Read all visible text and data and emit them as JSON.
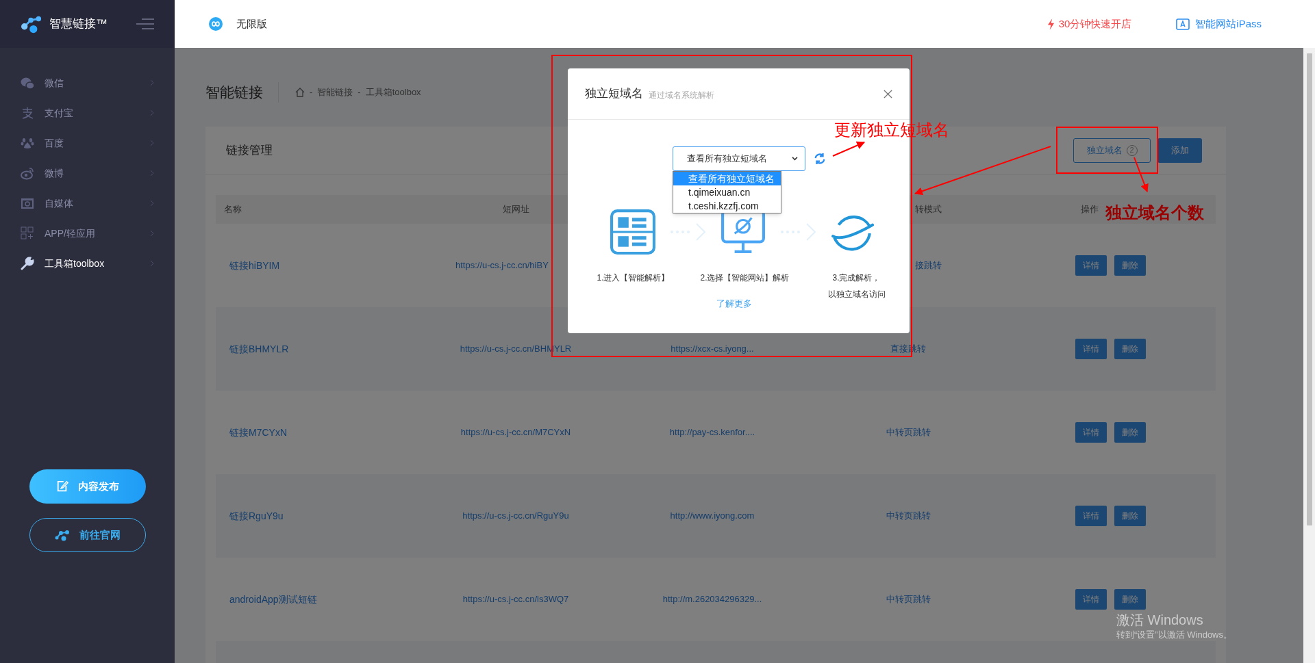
{
  "sidebar": {
    "logo_text": "智慧链接™",
    "items": [
      {
        "label": "微信",
        "kind": "wechat",
        "selected": false
      },
      {
        "label": "支付宝",
        "kind": "alipay",
        "selected": false
      },
      {
        "label": "百度",
        "kind": "baidu",
        "selected": false
      },
      {
        "label": "微博",
        "kind": "weibo",
        "selected": false
      },
      {
        "label": "自媒体",
        "kind": "media",
        "selected": false
      },
      {
        "label": "APP/轻应用",
        "kind": "app",
        "selected": false
      },
      {
        "label": "工具箱toolbox",
        "kind": "toolbox",
        "selected": true
      }
    ],
    "buttons": [
      {
        "label": "内容发布",
        "kind": "primary"
      },
      {
        "label": "前往官网",
        "kind": "outline"
      }
    ]
  },
  "top_bar": {
    "edition": "无限版",
    "links": [
      {
        "label": "30分钟快速开店",
        "kind": "promo"
      },
      {
        "label": "智能网站iPass",
        "kind": "site"
      }
    ]
  },
  "page": {
    "title": "智能链接",
    "breadcrumb_separator": "-",
    "breadcrumb": [
      "智能链接",
      "工具箱toolbox"
    ]
  },
  "card": {
    "title": "链接管理",
    "domain_button": {
      "label": "独立域名",
      "count": "2"
    },
    "add_button": "添加"
  },
  "table": {
    "columns": {
      "name": "名称",
      "short_url": "短网址",
      "column_4": "转模式",
      "actions": "操作"
    },
    "rows": [
      {
        "name": "链接hiBYIM",
        "short_url": "https://u-cs.j-cc.cn/hiBY",
        "column_4": "接跳转",
        "actions": [
          "详情",
          "删除"
        ]
      },
      {
        "name": "链接BHMYLR",
        "short_url": "https://u-cs.j-cc.cn/BHMYLR",
        "column_3": "https://xcx-cs.iyong...",
        "column_4": "直接跳转",
        "actions": [
          "详情",
          "删除"
        ]
      },
      {
        "name": "链接M7CYxN",
        "short_url": "https://u-cs.j-cc.cn/M7CYxN",
        "column_3": "http://pay-cs.kenfor....",
        "column_4": "中转页跳转",
        "actions": [
          "详情",
          "删除"
        ]
      },
      {
        "name": "链接RguY9u",
        "short_url": "https://u-cs.j-cc.cn/RguY9u",
        "column_3": "http://www.iyong.com",
        "column_4": "中转页跳转",
        "actions": [
          "详情",
          "删除"
        ]
      },
      {
        "name": "androidApp测试短链",
        "short_url": "https://u-cs.j-cc.cn/ls3WQ7",
        "column_3": "http://m.262034296329...",
        "column_4": "中转页跳转",
        "actions": [
          "详情",
          "删除"
        ]
      }
    ]
  },
  "modal": {
    "title": "独立短域名",
    "subtitle": "通过域名系统解析",
    "select_value": "查看所有独立短域名",
    "options": [
      {
        "label": "查看所有独立短域名",
        "selected": true
      },
      {
        "label": "t.qimeixuan.cn",
        "selected": false
      },
      {
        "label": "t.ceshi.kzzfj.com",
        "selected": false
      }
    ],
    "steps": [
      {
        "kind": "grid",
        "lines": [
          "1.进入【智能解析】"
        ]
      },
      {
        "kind": "monitor",
        "lines": [
          "2.选择【智能网站】解析"
        ]
      },
      {
        "kind": "planet",
        "lines": [
          "3.完成解析，",
          "以独立域名访问"
        ]
      }
    ],
    "link": "了解更多"
  },
  "annotations": [
    "更新独立短域名",
    "独立域名个数"
  ],
  "system_notice": {
    "title": "激活 Windows",
    "text": "转到“设置”以激活 Windows。"
  }
}
